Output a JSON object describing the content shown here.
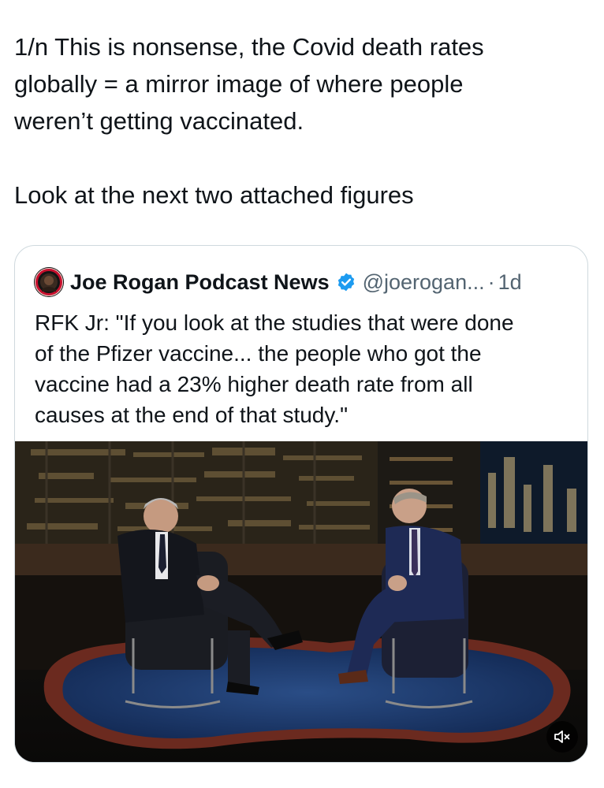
{
  "tweet": {
    "lines": [
      "1/n This is nonsense, the Covid death rates",
      "globally = a mirror image of where people",
      "weren’t getting vaccinated.",
      "Look at the next two attached figures"
    ]
  },
  "quoted_tweet": {
    "author_name": "Joe Rogan Podcast News",
    "handle": "@joerogan...",
    "separator": "·",
    "time": "1d",
    "text_lines": [
      "RFK Jr: \"If you look at the studies that were done",
      "of the Pfizer vaccine... the people who got the",
      "vaccine had a 23% higher death rate from all",
      "causes at the end of that study.\""
    ],
    "avatar_icon": "podcast-avatar-icon",
    "verified_icon": "verified-badge-icon",
    "verified_color": "#1d9bf0",
    "media": {
      "type": "video",
      "mute_icon": "mute-speaker-icon"
    }
  }
}
